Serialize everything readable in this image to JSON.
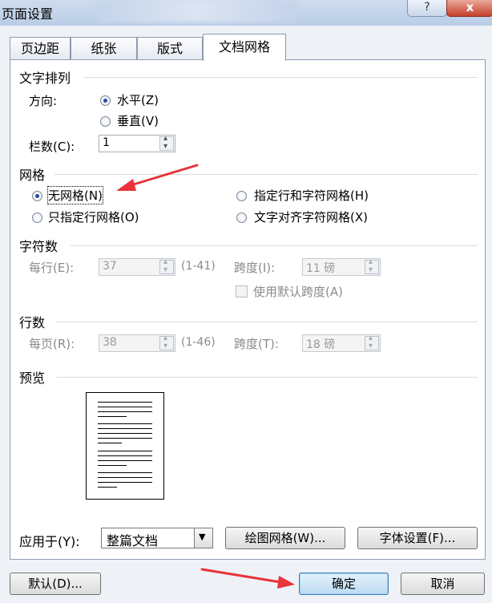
{
  "window": {
    "title": "页面设置",
    "help_label": "?",
    "close_label": "x"
  },
  "tabs": [
    "页边距",
    "纸张",
    "版式",
    "文档网格"
  ],
  "text_direction": {
    "section_title": "文字排列",
    "direction_label": "方向:",
    "horizontal_label": "水平(Z)",
    "vertical_label": "垂直(V)",
    "selected": "horizontal",
    "columns_label": "栏数(C):",
    "columns_value": "1"
  },
  "grid": {
    "section_title": "网格",
    "options": [
      "无网格(N)",
      "指定行和字符网格(H)",
      "只指定行网格(O)",
      "文字对齐字符网格(X)"
    ],
    "selected_index": 0
  },
  "characters": {
    "section_title": "字符数",
    "per_line_label": "每行(E):",
    "per_line_value": "37",
    "per_line_range": "(1-41)",
    "pitch_label": "跨度(I):",
    "pitch_value": "11 磅",
    "use_default_pitch_label": "使用默认跨度(A)"
  },
  "lines": {
    "section_title": "行数",
    "per_page_label": "每页(R):",
    "per_page_value": "38",
    "per_page_range": "(1-46)",
    "pitch_label": "跨度(T):",
    "pitch_value": "18 磅"
  },
  "preview": {
    "section_title": "预览"
  },
  "apply": {
    "label": "应用于(Y):",
    "value": "整篇文档",
    "drawing_grid_button": "绘图网格(W)...",
    "font_settings_button": "字体设置(F)..."
  },
  "footer": {
    "default_button": "默认(D)...",
    "ok_button": "确定",
    "cancel_button": "取消"
  },
  "colors": {
    "annotation_arrow": "#e8343a",
    "panel_bg": "#ffffff",
    "dialog_bg": "#eef2f7"
  }
}
